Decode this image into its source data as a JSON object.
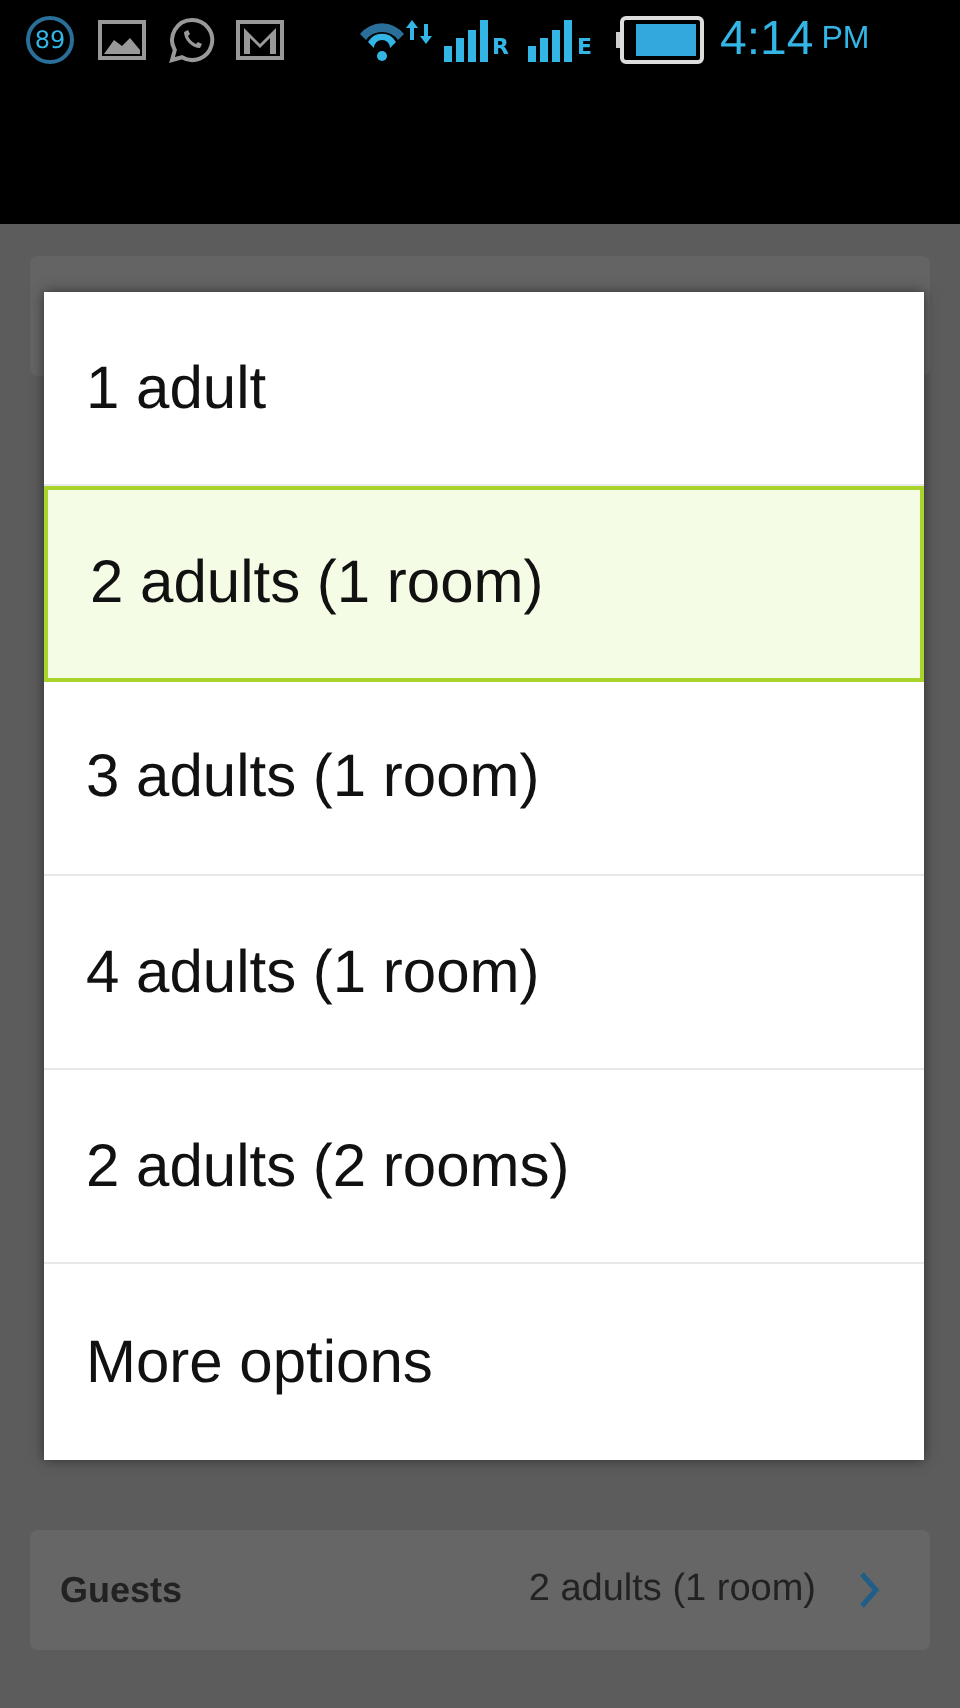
{
  "status_bar": {
    "notification_count": "89",
    "signal_1_label": "R",
    "signal_2_label": "E",
    "time": "4:14",
    "time_suffix": "PM"
  },
  "dialog": {
    "options": [
      {
        "label": "1 adult",
        "selected": false
      },
      {
        "label": "2 adults (1 room)",
        "selected": true
      },
      {
        "label": "3 adults (1 room)",
        "selected": false
      },
      {
        "label": "4 adults (1 room)",
        "selected": false
      },
      {
        "label": "2 adults (2 rooms)",
        "selected": false
      },
      {
        "label": "More options",
        "selected": false
      }
    ]
  },
  "guests_row": {
    "label": "Guests",
    "value": "2 adults (1 room)"
  }
}
